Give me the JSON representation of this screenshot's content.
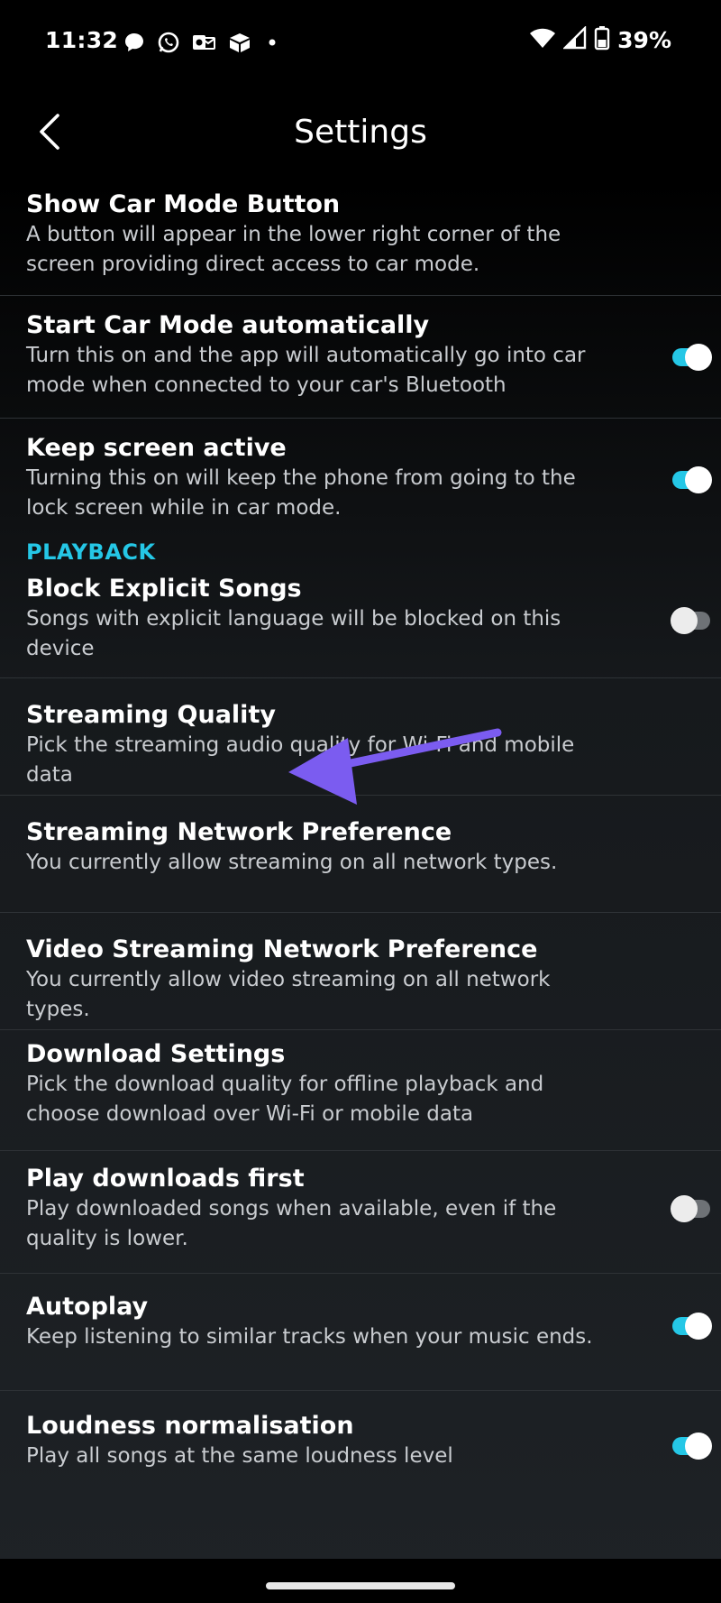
{
  "status_bar": {
    "time": "11:32",
    "battery": "39%",
    "icons_left": [
      "chat-bubble-icon",
      "whatsapp-icon",
      "outlook-icon",
      "box-icon",
      "dot-icon"
    ],
    "icons_right": [
      "wifi-icon",
      "signal-icon",
      "battery-icon"
    ]
  },
  "header": {
    "title": "Settings",
    "back_icon": "chevron-left-icon"
  },
  "accent_color": "#25c7e6",
  "annotation_arrow_color": "#7b5cf0",
  "settings": [
    {
      "title": "Show Car Mode Button",
      "description": "A button will appear in the lower right corner of the screen providing direct access to car mode.",
      "toggle": null
    },
    {
      "title": "Start Car Mode automatically",
      "description": "Turn this on and the app will automatically go into car mode when connected to your car's Bluetooth",
      "toggle": true
    },
    {
      "title": "Keep screen active",
      "description": "Turning this on will keep the phone from going to the lock screen while in car mode.",
      "toggle": true
    }
  ],
  "playback": {
    "section_label": "PLAYBACK",
    "items": [
      {
        "title": "Block Explicit Songs",
        "description": "Songs with explicit language will be blocked on this device",
        "toggle": false
      },
      {
        "title": "Streaming Quality",
        "description": "Pick the streaming audio quality for Wi-Fi and mobile data",
        "toggle": null
      },
      {
        "title": "Streaming Network Preference",
        "description": "You currently allow streaming on all network types.",
        "toggle": null
      },
      {
        "title": "Video Streaming Network Preference",
        "description": "You currently allow video streaming on all network types.",
        "toggle": null
      },
      {
        "title": "Download Settings",
        "description": "Pick the download quality for offline playback and choose download over Wi-Fi or mobile data",
        "toggle": null
      },
      {
        "title": "Play downloads first",
        "description": "Play downloaded songs when available, even if the quality is lower.",
        "toggle": false
      },
      {
        "title": "Autoplay",
        "description": "Keep listening to similar tracks when your music ends.",
        "toggle": true
      },
      {
        "title": "Loudness normalisation",
        "description": "Play all songs at the same loudness level",
        "toggle": true
      }
    ]
  }
}
